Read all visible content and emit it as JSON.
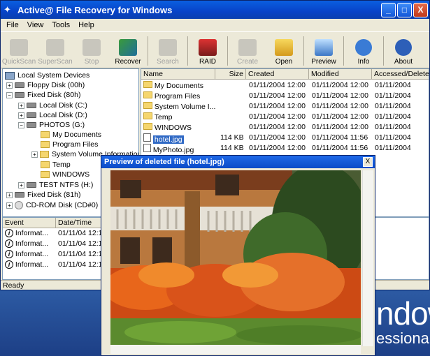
{
  "window": {
    "title": "Active@ File Recovery for Windows",
    "controls": [
      "_",
      "□",
      "X"
    ]
  },
  "menu": [
    "File",
    "View",
    "Tools",
    "Help"
  ],
  "toolbar": [
    {
      "label": "QuickScan",
      "icon": "quickscan-icon",
      "enabled": false
    },
    {
      "label": "SuperScan",
      "icon": "superscan-icon",
      "enabled": false
    },
    {
      "label": "Stop",
      "icon": "stop-icon",
      "enabled": false
    },
    {
      "label": "Recover",
      "icon": "recover-icon",
      "enabled": true
    },
    {
      "label": "Search",
      "icon": "search-icon",
      "enabled": false
    },
    {
      "label": "RAID",
      "icon": "raid-icon",
      "enabled": true
    },
    {
      "label": "Create",
      "icon": "create-icon",
      "enabled": false
    },
    {
      "label": "Open",
      "icon": "open-icon",
      "enabled": true
    },
    {
      "label": "Preview",
      "icon": "preview-icon",
      "enabled": true
    },
    {
      "label": "Info",
      "icon": "info-icon",
      "enabled": true
    },
    {
      "label": "About",
      "icon": "about-icon",
      "enabled": true
    }
  ],
  "tree": [
    {
      "label": "Local System Devices",
      "icon": "pc"
    },
    {
      "label": "Floppy Disk (00h)",
      "icon": "drive"
    },
    {
      "label": "Fixed Disk (80h)",
      "icon": "drive"
    },
    {
      "label": "Local Disk (C:)",
      "icon": "drive"
    },
    {
      "label": "Local Disk (D:)",
      "icon": "drive"
    },
    {
      "label": "PHOTOS (G:)",
      "icon": "drive"
    },
    {
      "label": "My Documents",
      "icon": "folder"
    },
    {
      "label": "Program Files",
      "icon": "folder"
    },
    {
      "label": "System Volume Information",
      "icon": "folder"
    },
    {
      "label": "Temp",
      "icon": "folder"
    },
    {
      "label": "WINDOWS",
      "icon": "folder"
    },
    {
      "label": "TEST NTFS (H:)",
      "icon": "drive"
    },
    {
      "label": "Fixed Disk (81h)",
      "icon": "drive"
    },
    {
      "label": "CD-ROM Disk (CD#0)",
      "icon": "cd"
    }
  ],
  "files": {
    "columns": [
      "Name",
      "Size",
      "Created",
      "Modified",
      "Accessed/Deleted"
    ],
    "rows": [
      {
        "name": "My Documents",
        "size": "",
        "created": "01/11/2004 12:00",
        "modified": "01/11/2004 12:00",
        "accessed": "01/11/2004"
      },
      {
        "name": "Program Files",
        "size": "",
        "created": "01/11/2004 12:00",
        "modified": "01/11/2004 12:00",
        "accessed": "01/11/2004"
      },
      {
        "name": "System Volume I...",
        "size": "",
        "created": "01/11/2004 12:00",
        "modified": "01/11/2004 12:00",
        "accessed": "01/11/2004"
      },
      {
        "name": "Temp",
        "size": "",
        "created": "01/11/2004 12:00",
        "modified": "01/11/2004 12:00",
        "accessed": "01/11/2004"
      },
      {
        "name": "WINDOWS",
        "size": "",
        "created": "01/11/2004 12:00",
        "modified": "01/11/2004 12:00",
        "accessed": "01/11/2004"
      },
      {
        "name": "hotel.jpg",
        "size": "114 KB",
        "created": "01/11/2004 12:00",
        "modified": "01/11/2004 11:56",
        "accessed": "01/11/2004"
      },
      {
        "name": "MyPhoto.jpg",
        "size": "114 KB",
        "created": "01/11/2004 12:00",
        "modified": "01/11/2004 11:56",
        "accessed": "01/11/2004"
      }
    ]
  },
  "events": {
    "columns": [
      "Event",
      "Date/Time"
    ],
    "rows": [
      {
        "event": "Informat...",
        "datetime": "01/11/04 12:1"
      },
      {
        "event": "Informat...",
        "datetime": "01/11/04 12:1"
      },
      {
        "event": "Informat...",
        "datetime": "01/11/04 12:1"
      },
      {
        "event": "Informat...",
        "datetime": "01/11/04 12:1"
      }
    ]
  },
  "status": "Ready",
  "preview": {
    "title": "Preview of deleted file (hotel.jpg)",
    "close": "X"
  },
  "desktop": {
    "text_big": "ndow",
    "text_small": "essiona"
  }
}
